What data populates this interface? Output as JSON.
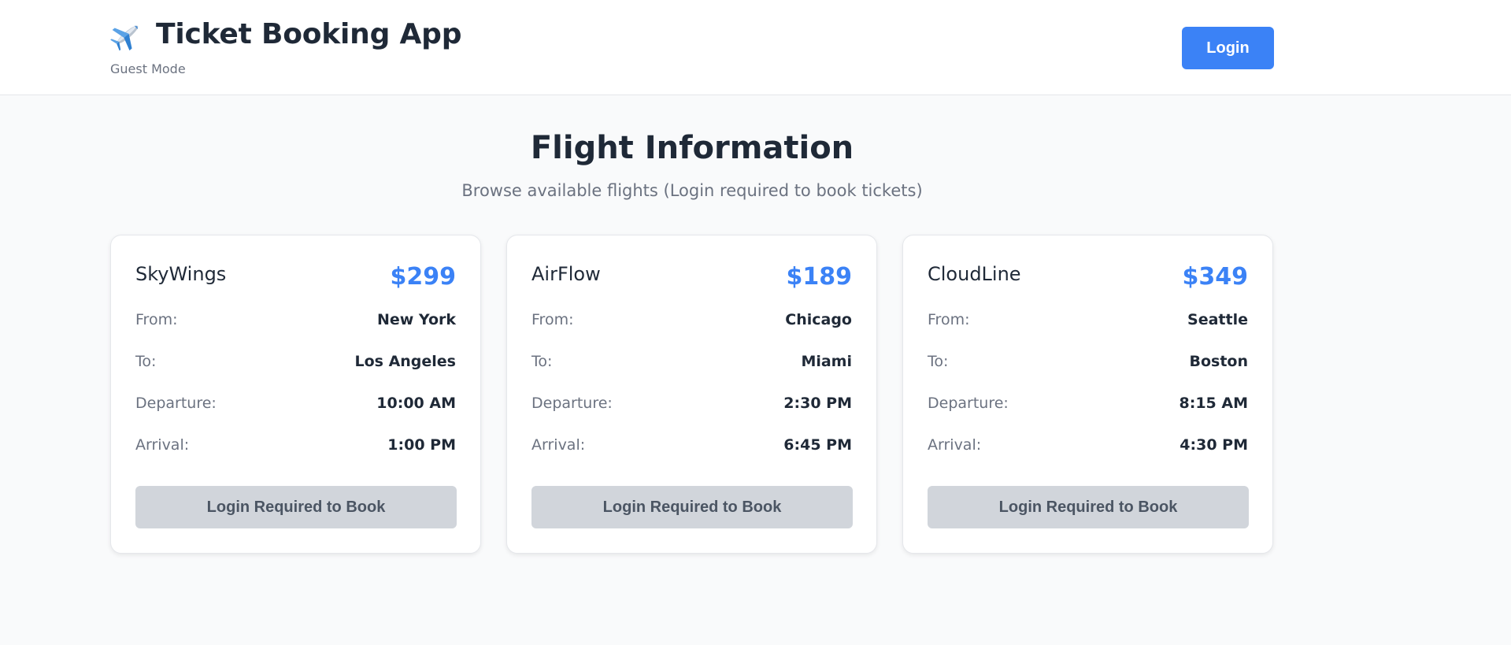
{
  "header": {
    "app_icon": "airplane-icon",
    "title": "Ticket Booking App",
    "mode": "Guest Mode",
    "login_label": "Login"
  },
  "main": {
    "title": "Flight Information",
    "subtitle": "Browse available flights (Login required to book tickets)"
  },
  "labels": {
    "from": "From:",
    "to": "To:",
    "departure": "Departure:",
    "arrival": "Arrival:",
    "book": "Login Required to Book"
  },
  "flights": [
    {
      "airline": "SkyWings",
      "price": "$299",
      "from": "New York",
      "to": "Los Angeles",
      "departure": "10:00 AM",
      "arrival": "1:00 PM"
    },
    {
      "airline": "AirFlow",
      "price": "$189",
      "from": "Chicago",
      "to": "Miami",
      "departure": "2:30 PM",
      "arrival": "6:45 PM"
    },
    {
      "airline": "CloudLine",
      "price": "$349",
      "from": "Seattle",
      "to": "Boston",
      "departure": "8:15 AM",
      "arrival": "4:30 PM"
    }
  ],
  "colors": {
    "accent": "#3b82f6",
    "disabled_button": "#d1d5db",
    "background": "#f9fafb",
    "text": "#1f2937",
    "muted_text": "#6b7280"
  }
}
